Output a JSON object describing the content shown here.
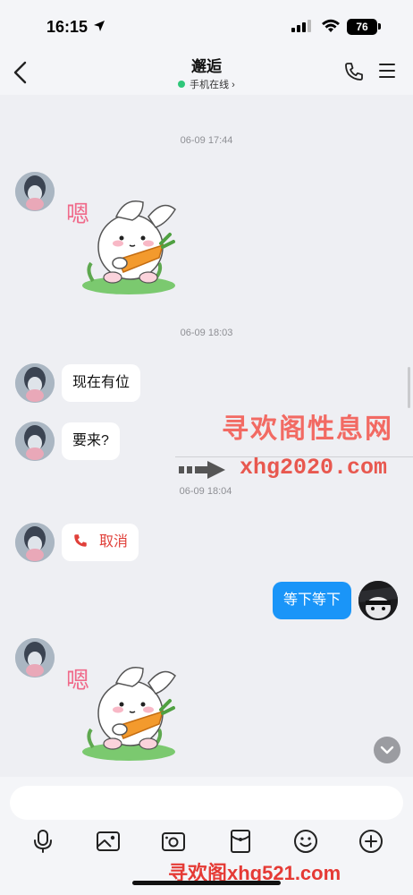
{
  "status_bar": {
    "time": "16:15",
    "battery": "76"
  },
  "header": {
    "title": "邂逅",
    "status": "手机在线"
  },
  "messages": {
    "ts1": "06-09 17:44",
    "ts2": "06-09 18:03",
    "ts3": "06-09 18:04",
    "msg1": "现在有位",
    "msg2": "要来?",
    "call": "取消",
    "mine1": "等下等下",
    "sticker_text": "嗯"
  },
  "watermark": {
    "title": "寻欢阁性息网",
    "url": "xhg2020.com",
    "bottom": "寻欢阁xhg521.com"
  },
  "input": {
    "placeholder": ""
  },
  "colors": {
    "accent": "#1a95f8",
    "online": "#2fc77a",
    "call_red": "#e0403a",
    "watermark": "#f26a63"
  },
  "icons": [
    "location-arrow-icon",
    "signal-icon",
    "wifi-icon",
    "back-icon",
    "phone-icon",
    "menu-icon",
    "call-icon",
    "mic-icon",
    "image-icon",
    "camera-icon",
    "red-packet-icon",
    "emoji-icon",
    "plus-icon",
    "chevron-down-icon"
  ]
}
